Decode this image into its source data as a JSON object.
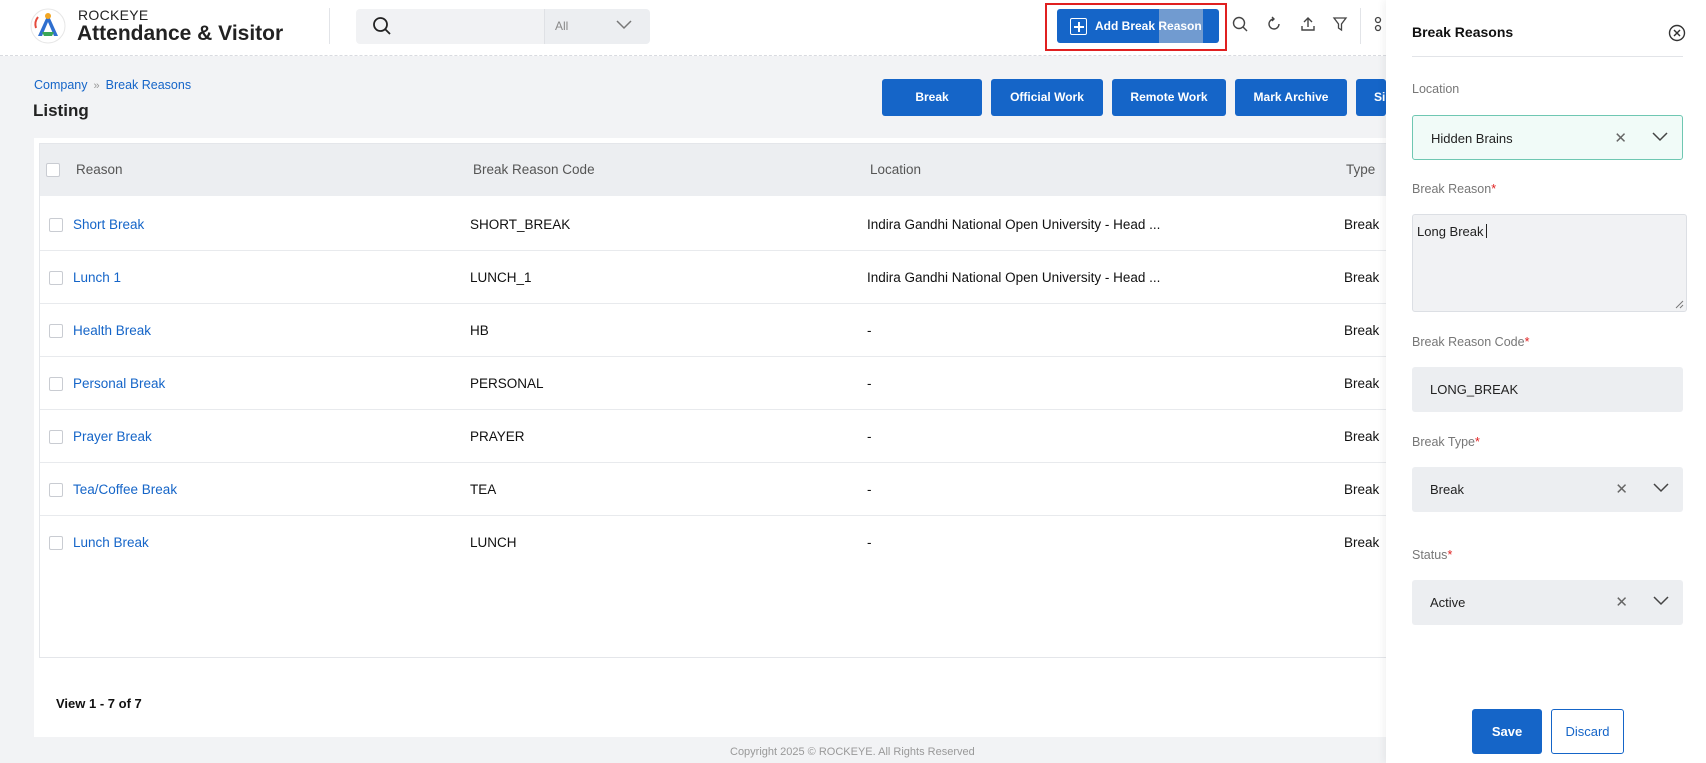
{
  "header": {
    "brand_top": "ROCKEYE",
    "brand_main": "Attendance & Visitor",
    "search": {
      "placeholder": "",
      "filter_value": "All"
    },
    "add_button_label": "Add Break Reason",
    "icons": [
      "search-icon",
      "refresh-icon",
      "upload-icon",
      "filter-icon",
      "grid-icon"
    ]
  },
  "breadcrumb": {
    "parent": "Company",
    "current": "Break Reasons"
  },
  "page_title": "Listing",
  "actions": [
    "Break",
    "Official Work",
    "Remote Work",
    "Mark Archive",
    "Si"
  ],
  "table": {
    "headers": {
      "reason": "Reason",
      "code": "Break Reason Code",
      "location": "Location",
      "type": "Type"
    },
    "rows": [
      {
        "reason": "Short Break",
        "code": "SHORT_BREAK",
        "location": "Indira Gandhi National Open University - Head ...",
        "type": "Break"
      },
      {
        "reason": "Lunch 1",
        "code": "LUNCH_1",
        "location": "Indira Gandhi National Open University - Head ...",
        "type": "Break"
      },
      {
        "reason": "Health Break",
        "code": "HB",
        "location": "-",
        "type": "Break"
      },
      {
        "reason": "Personal Break",
        "code": "PERSONAL",
        "location": "-",
        "type": "Break"
      },
      {
        "reason": "Prayer Break",
        "code": "PRAYER",
        "location": "-",
        "type": "Break"
      },
      {
        "reason": "Tea/Coffee Break",
        "code": "TEA",
        "location": "-",
        "type": "Break"
      },
      {
        "reason": "Lunch Break",
        "code": "LUNCH",
        "location": "-",
        "type": "Break"
      }
    ],
    "pagination": "View 1 - 7 of 7"
  },
  "footer": "Copyright 2025 © ROCKEYE. All Rights Reserved",
  "panel": {
    "title": "Break Reasons",
    "location_label": "Location",
    "location_value": "Hidden Brains",
    "reason_label": "Break Reason",
    "reason_value": "Long Break",
    "code_label": "Break Reason Code",
    "code_value": "LONG_BREAK",
    "type_label": "Break Type",
    "type_value": "Break",
    "status_label": "Status",
    "status_value": "Active",
    "required_mark": "*",
    "save_label": "Save",
    "discard_label": "Discard"
  },
  "colors": {
    "primary": "#1565c8",
    "highlight": "#e02020",
    "accent_green": "#6fc7b2"
  }
}
